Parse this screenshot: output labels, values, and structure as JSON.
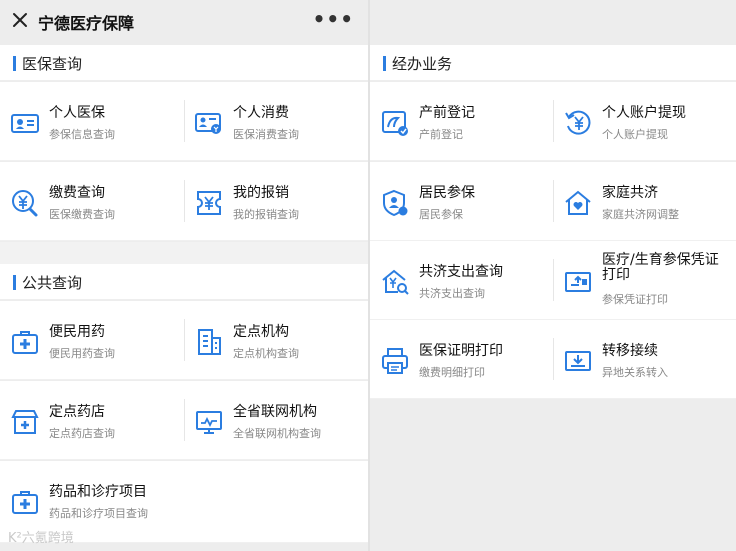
{
  "app": {
    "title": "宁德医疗保障",
    "more_label": "•••"
  },
  "colors": {
    "accent": "#2b7de0",
    "icon_blue": "#2b7de0"
  },
  "medical_query": {
    "header": "医保查询",
    "items": [
      {
        "name": "个人医保",
        "sub": "参保信息查询",
        "icon": "id-card-icon"
      },
      {
        "name": "个人消费",
        "sub": "医保消费查询",
        "icon": "consumption-card-icon"
      },
      {
        "name": "缴费查询",
        "sub": "医保缴费查询",
        "icon": "yuan-search-icon"
      },
      {
        "name": "我的报销",
        "sub": "我的报销查询",
        "icon": "receipt-icon"
      }
    ]
  },
  "public_query": {
    "header": "公共查询",
    "items": [
      {
        "name": "便民用药",
        "sub": "便民用药查询",
        "icon": "medkit-icon"
      },
      {
        "name": "定点机构",
        "sub": "定点机构查询",
        "icon": "building-icon"
      },
      {
        "name": "定点药店",
        "sub": "定点药店查询",
        "icon": "pharmacy-store-icon"
      },
      {
        "name": "全省联网机构",
        "sub": "全省联网机构查询",
        "icon": "monitor-network-icon"
      },
      {
        "name": "药品和诊疗项目",
        "sub": "药品和诊疗项目查询",
        "icon": "medkit-icon"
      }
    ]
  },
  "services": {
    "header": "经办业务",
    "items": [
      {
        "name": "产前登记",
        "sub": "产前登记",
        "icon": "prenatal-icon"
      },
      {
        "name": "个人账户提现",
        "sub": "个人账户提现",
        "icon": "withdraw-icon"
      },
      {
        "name": "居民参保",
        "sub": "居民参保",
        "icon": "resident-shield-icon"
      },
      {
        "name": "家庭共济",
        "sub": "家庭共济网调整",
        "icon": "family-home-icon"
      },
      {
        "name": "共济支出查询",
        "sub": "共济支出查询",
        "icon": "mutual-expense-icon"
      },
      {
        "name": "医疗/生育参保凭证打印",
        "sub": "参保凭证打印",
        "icon": "certificate-print-icon"
      },
      {
        "name": "医保证明打印",
        "sub": "缴费明细打印",
        "icon": "printer-icon"
      },
      {
        "name": "转移接续",
        "sub": "异地关系转入",
        "icon": "transfer-icon"
      }
    ]
  },
  "watermark": "K²六氪跨境"
}
